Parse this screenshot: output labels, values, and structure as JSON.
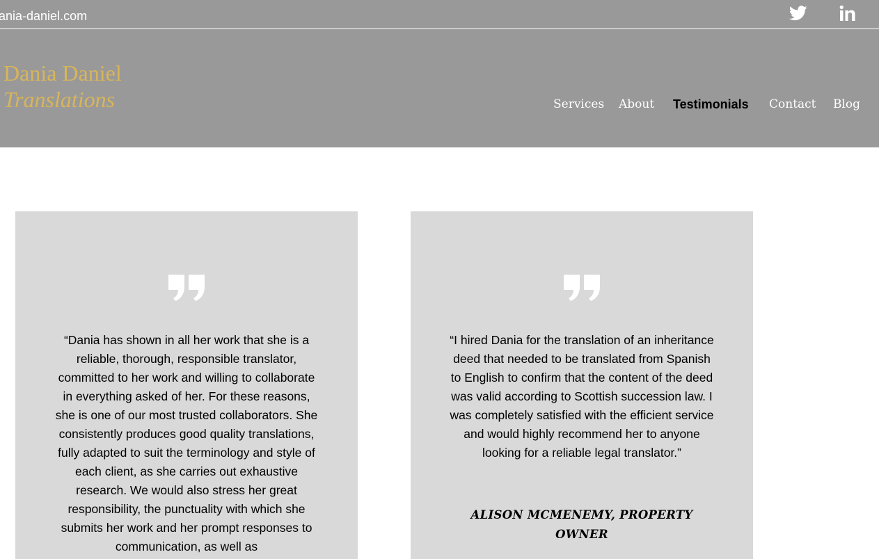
{
  "topbar": {
    "email": "ania-daniel.com",
    "social": [
      {
        "icon": "twitter-icon"
      },
      {
        "icon": "linkedin-icon"
      }
    ]
  },
  "logo": {
    "line1": "Dania Daniel",
    "line2": "Translations"
  },
  "nav": {
    "items": [
      "Services",
      "About",
      "Testimonials",
      "Contact",
      "Blog"
    ],
    "active": "Testimonials"
  },
  "testimonials": [
    {
      "quote": "“Dania has shown in all her work that she is a reliable, thorough, responsible translator, committed to her work and willing to collaborate in everything asked of her. For these reasons, she is one of our most trusted collaborators. She consistently produces good quality translations, fully adapted to suit the terminology and style of each client, as she carries out exhaustive research. We would also stress her great responsibility, the punctuality with which she submits her work and her prompt responses to communication, as well as",
      "author": ""
    },
    {
      "quote": "“I hired Dania for the translation of an inheritance deed that needed to be translated from Spanish to English to confirm that the content of the deed was valid according to Scottish succession law. I was completely satisfied with the efficient service and would highly recommend her to anyone looking for a reliable legal translator.”",
      "author": "ALISON MCMENEMY, PROPERTY OWNER"
    }
  ],
  "colors": {
    "header_bg": "#999999",
    "logo_gold": "#d8b55a",
    "card_bg": "#d9d9d9",
    "text": "#000000",
    "white": "#ffffff"
  }
}
